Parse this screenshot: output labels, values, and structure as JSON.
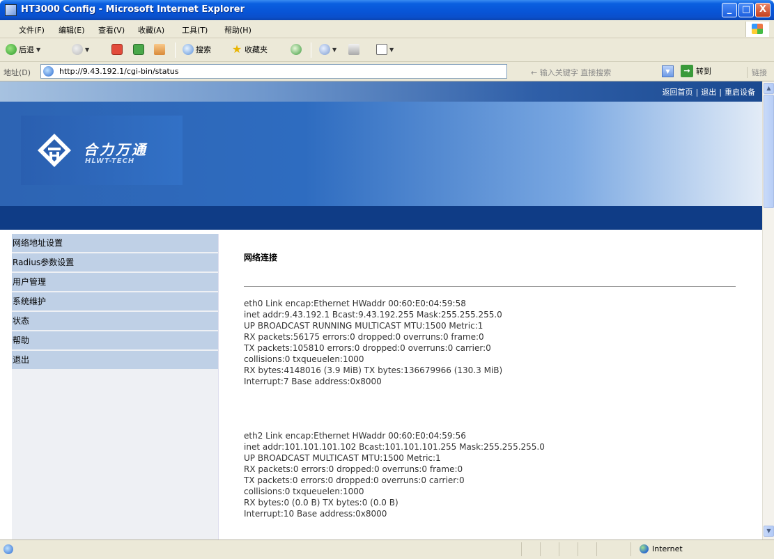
{
  "window": {
    "title": "HT3000 Config - Microsoft Internet Explorer",
    "minimize": "_",
    "maximize": "□",
    "close": "X"
  },
  "menubar": [
    "文件(F)",
    "编辑(E)",
    "查看(V)",
    "收藏(A)",
    "工具(T)",
    "帮助(H)"
  ],
  "toolbar": {
    "back": "后退",
    "search": "搜索",
    "favorites": "收藏夹"
  },
  "addressbar": {
    "label": "地址(D)",
    "url": "http://9.43.192.1/cgi-bin/status",
    "search_placeholder": "← 输入关键字 直接搜索",
    "go": "转到",
    "links": "链接"
  },
  "page": {
    "top_links": [
      "返回首页",
      "退出",
      "重启设备"
    ],
    "logo": {
      "cn": "合力万通",
      "en": "HLWT-TECH"
    },
    "sidebar": [
      "网络地址设置",
      "Radius参数设置",
      "用户管理",
      "系统维护",
      "状态",
      "帮助",
      "退出"
    ],
    "heading": "网络连接",
    "interfaces": [
      [
        "eth0 Link encap:Ethernet HWaddr 00:60:E0:04:59:58",
        "inet addr:9.43.192.1 Bcast:9.43.192.255 Mask:255.255.255.0",
        "UP BROADCAST RUNNING MULTICAST MTU:1500 Metric:1",
        "RX packets:56175 errors:0 dropped:0 overruns:0 frame:0",
        "TX packets:105810 errors:0 dropped:0 overruns:0 carrier:0",
        "collisions:0 txqueuelen:1000",
        "RX bytes:4148016 (3.9 MiB) TX bytes:136679966 (130.3 MiB)",
        "Interrupt:7 Base address:0x8000"
      ],
      [
        "eth2 Link encap:Ethernet HWaddr 00:60:E0:04:59:56",
        "inet addr:101.101.101.102 Bcast:101.101.101.255 Mask:255.255.255.0",
        "UP BROADCAST MULTICAST MTU:1500 Metric:1",
        "RX packets:0 errors:0 dropped:0 overruns:0 frame:0",
        "TX packets:0 errors:0 dropped:0 overruns:0 carrier:0",
        "collisions:0 txqueuelen:1000",
        "RX bytes:0 (0.0 B) TX bytes:0 (0.0 B)",
        "Interrupt:10 Base address:0x8000"
      ]
    ]
  },
  "statusbar": {
    "zone": "Internet"
  }
}
